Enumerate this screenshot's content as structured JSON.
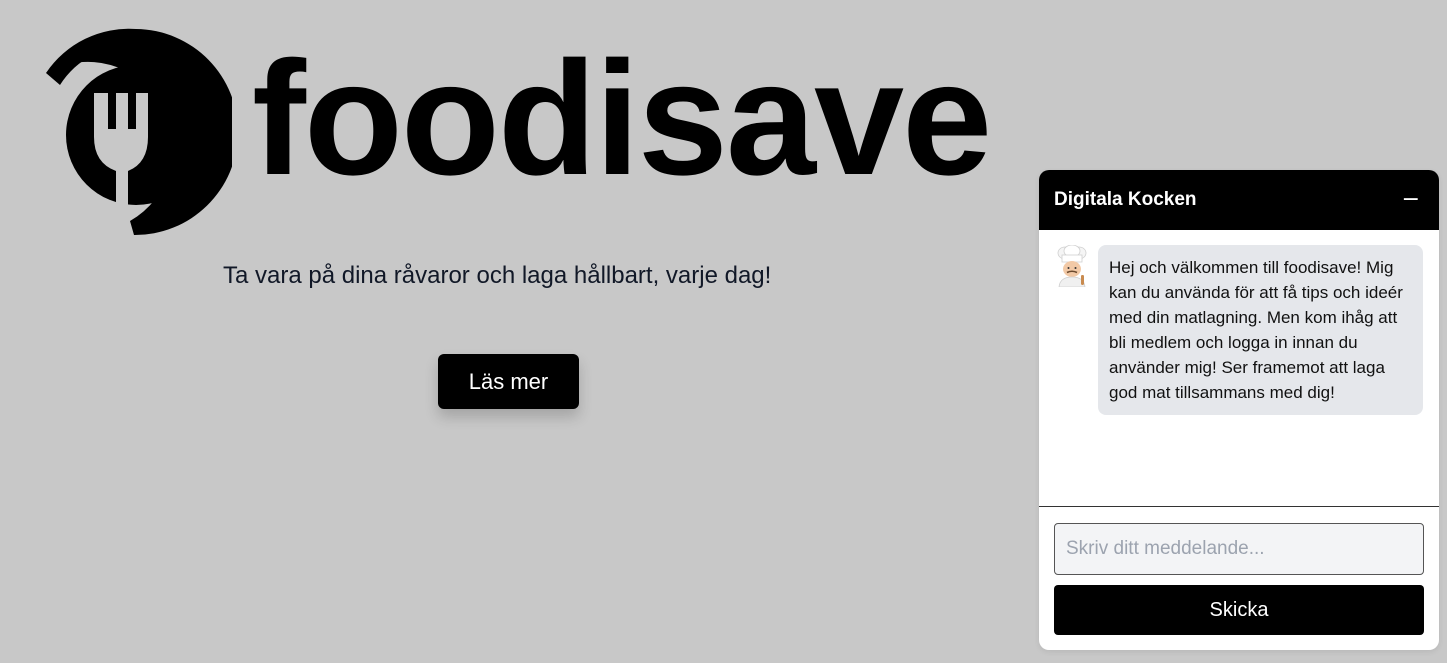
{
  "hero": {
    "logo_text": "foodisave",
    "logo_icon": "fork-plate-icon",
    "tagline": "Ta vara på dina råvaror och laga hållbart, varje dag!",
    "cta_label": "Läs mer"
  },
  "chat": {
    "title": "Digitala Kocken",
    "minimize_label": "−",
    "messages": [
      {
        "sender_icon": "chef-avatar-icon",
        "text": "Hej och välkommen till foodisave! Mig kan du använda för att få tips och ideér med din matlagning. Men kom ihåg att bli medlem och logga in innan du använder mig! Ser framemot att laga god mat tillsammans med dig!"
      }
    ],
    "input_placeholder": "Skriv ditt meddelande...",
    "input_value": "",
    "send_label": "Skicka"
  },
  "colors": {
    "background": "#c8c8c8",
    "primary": "#000000",
    "bubble": "#e5e7eb"
  }
}
